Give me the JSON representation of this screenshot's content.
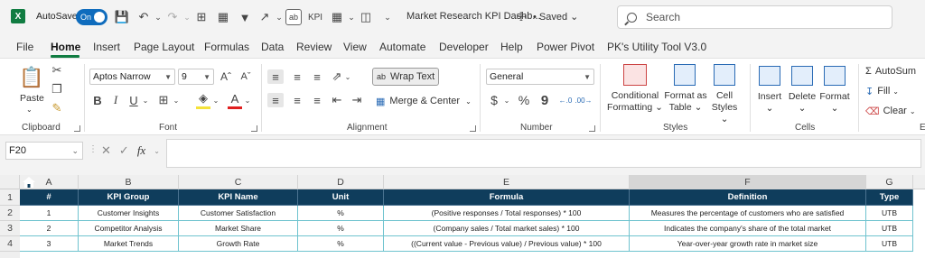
{
  "titlebar": {
    "app_logo": "X",
    "autosave_label": "AutoSave",
    "autosave_state": "On",
    "document_title": "Market Research KPI Dashb...",
    "saved_status": "• Saved",
    "search_placeholder": "Search"
  },
  "menu": [
    "File",
    "Home",
    "Insert",
    "Page Layout",
    "Formulas",
    "Data",
    "Review",
    "View",
    "Automate",
    "Developer",
    "Help",
    "Power Pivot",
    "PK's Utility Tool V3.0"
  ],
  "ribbon": {
    "clipboard": {
      "paste_label": "Paste",
      "group_label": "Clipboard"
    },
    "font": {
      "font_name": "Aptos Narrow",
      "font_size": "9",
      "group_label": "Font"
    },
    "alignment": {
      "wrap_text": "Wrap Text",
      "merge_center": "Merge & Center",
      "group_label": "Alignment"
    },
    "number": {
      "format": "General",
      "group_label": "Number"
    },
    "styles": {
      "conditional_formatting_1": "Conditional",
      "conditional_formatting_2": "Formatting",
      "format_as_table_1": "Format as",
      "format_as_table_2": "Table",
      "cell_styles_1": "Cell",
      "cell_styles_2": "Styles",
      "group_label": "Styles"
    },
    "cells": {
      "insert": "Insert",
      "delete": "Delete",
      "format": "Format",
      "group_label": "Cells"
    },
    "editing": {
      "autosum": "AutoSum",
      "fill": "Fill",
      "clear": "Clear",
      "group_label": "E"
    }
  },
  "formula_bar": {
    "name_box": "F20",
    "fx": "fx",
    "content": ""
  },
  "columns": [
    "A",
    "B",
    "C",
    "D",
    "E",
    "F",
    "G"
  ],
  "rows": [
    "1",
    "2",
    "3",
    "4"
  ],
  "table": {
    "headers": [
      "#",
      "KPI Group",
      "KPI Name",
      "Unit",
      "Formula",
      "Definition",
      "Type"
    ],
    "rows": [
      [
        "1",
        "Customer Insights",
        "Customer Satisfaction",
        "%",
        "(Positive responses / Total responses) * 100",
        "Measures the percentage of customers who are satisfied",
        "UTB"
      ],
      [
        "2",
        "Competitor Analysis",
        "Market Share",
        "%",
        "(Company sales / Total market sales) * 100",
        "Indicates the company's share of the total market",
        "UTB"
      ],
      [
        "3",
        "Market Trends",
        "Growth Rate",
        "%",
        "((Current value - Previous value) / Previous value) * 100",
        "Year-over-year growth rate in market size",
        "UTB"
      ]
    ]
  },
  "colors": {
    "header_fill": "#0f3d5c",
    "border": "#6fc3cf",
    "accent": "#107c41"
  }
}
